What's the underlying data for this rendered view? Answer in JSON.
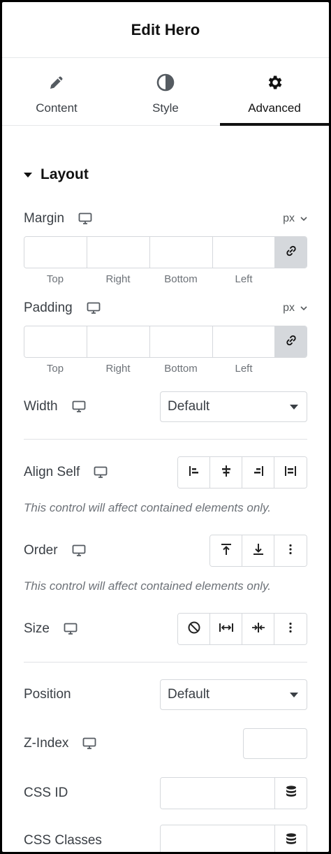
{
  "header": {
    "title": "Edit Hero"
  },
  "tabs": [
    {
      "label": "Content",
      "icon": "pencil-icon",
      "active": false
    },
    {
      "label": "Style",
      "icon": "half-circle-icon",
      "active": false
    },
    {
      "label": "Advanced",
      "icon": "gear-icon",
      "active": true
    }
  ],
  "layout": {
    "section_title": "Layout",
    "margin": {
      "label": "Margin",
      "unit": "px",
      "sides": [
        "Top",
        "Right",
        "Bottom",
        "Left"
      ]
    },
    "padding": {
      "label": "Padding",
      "unit": "px",
      "sides": [
        "Top",
        "Right",
        "Bottom",
        "Left"
      ]
    },
    "width": {
      "label": "Width",
      "value": "Default"
    },
    "align_self": {
      "label": "Align Self",
      "note": "This control will affect contained elements only."
    },
    "order": {
      "label": "Order",
      "note": "This control will affect contained elements only."
    },
    "size": {
      "label": "Size"
    },
    "position": {
      "label": "Position",
      "value": "Default"
    },
    "z_index": {
      "label": "Z-Index",
      "value": ""
    },
    "css_id": {
      "label": "CSS ID",
      "value": ""
    },
    "css_classes": {
      "label": "CSS Classes"
    }
  },
  "colors": {
    "text": "#3a3f45",
    "border": "#d5d8dc",
    "muted": "#6d7278",
    "accent": "#111111"
  }
}
